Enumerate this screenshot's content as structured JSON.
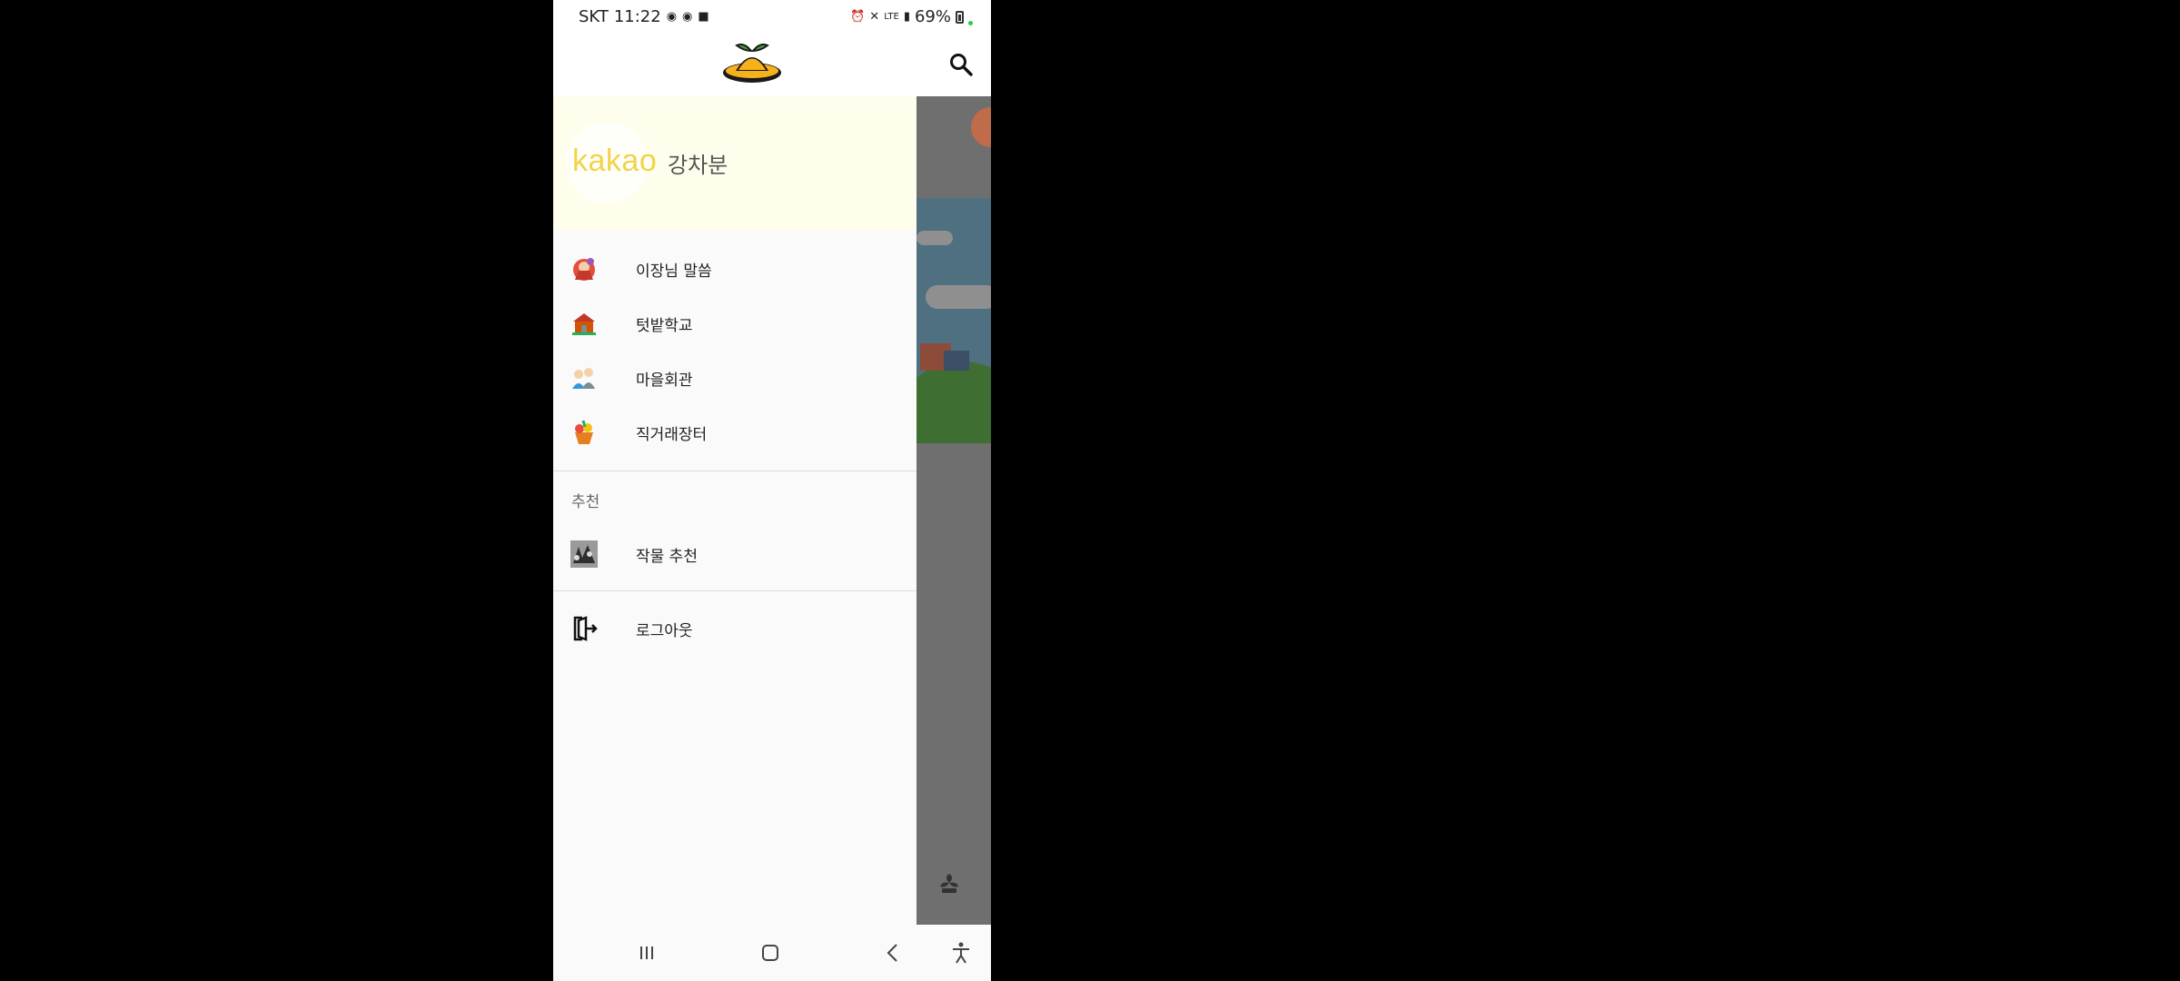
{
  "status_bar": {
    "carrier": "SKT",
    "time": "11:22",
    "network": "LTE",
    "battery": "69%"
  },
  "app_bar": {
    "logo_icon": "orange-hat-logo",
    "search_icon": "search-icon"
  },
  "drawer": {
    "profile": {
      "brand": "kakao",
      "name": "강차분"
    },
    "menu": [
      {
        "label": "이장님 말씀",
        "icon": "village-chief-icon"
      },
      {
        "label": "텃밭학교",
        "icon": "school-icon"
      },
      {
        "label": "마을회관",
        "icon": "people-icon"
      },
      {
        "label": "직거래장터",
        "icon": "produce-icon"
      }
    ],
    "section_recommend": "추천",
    "recommend_item": {
      "label": "작물 추천",
      "icon": "crop-photo-icon"
    },
    "logout": {
      "label": "로그아웃",
      "icon": "logout-icon"
    }
  },
  "colors": {
    "accent": "#F6B21B",
    "kakao": "#F2D34A",
    "profile_bg": "#FFFDEB"
  }
}
